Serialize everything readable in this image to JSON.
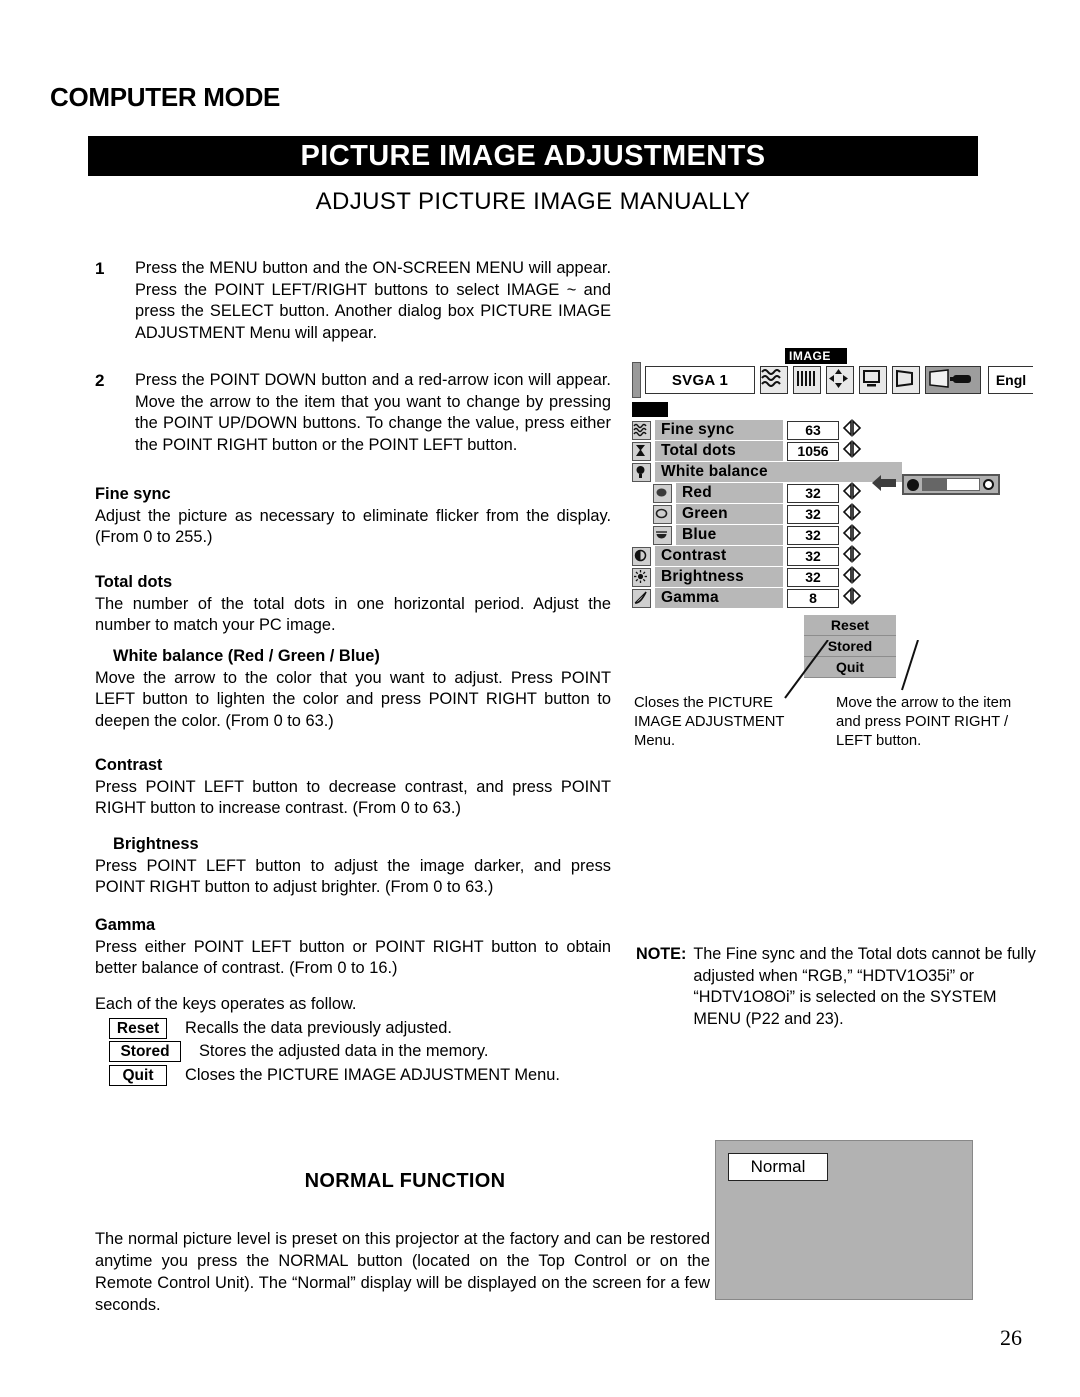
{
  "header": {
    "mode_title": "COMPUTER MODE",
    "banner_title": "PICTURE IMAGE ADJUSTMENTS",
    "subtitle": "ADJUST PICTURE IMAGE MANUALLY"
  },
  "steps": [
    {
      "number": "1",
      "text": "Press the MENU button and the ON-SCREEN MENU will appear. Press the POINT LEFT/RIGHT buttons to select IMAGE ~ and press the SELECT button. Another dialog box PICTURE IMAGE ADJUSTMENT Menu will appear."
    },
    {
      "number": "2",
      "text": "Press the POINT DOWN button and a red-arrow icon will appear. Move the arrow to the item that you want to change by pressing the POINT UP/DOWN buttons. To change the value, press either the POINT RIGHT button or the POINT LEFT button."
    }
  ],
  "sections": [
    {
      "heading": "Fine sync",
      "body": "Adjust the picture as necessary to eliminate flicker from the display. (From 0 to 255.)"
    },
    {
      "heading": "Total dots",
      "body": "The number of the total dots in one horizontal period. Adjust the number to match your PC image."
    },
    {
      "heading": "White balance (Red / Green / Blue)",
      "body": "Move the arrow to the color that you want to adjust. Press POINT LEFT button to lighten the color and press POINT RIGHT button to deepen the color. (From 0 to 63.)"
    },
    {
      "heading": "Contrast",
      "body": "Press POINT LEFT button to decrease contrast, and press POINT RIGHT button to increase contrast. (From 0 to 63.)"
    },
    {
      "heading": "Brightness",
      "body": "Press POINT LEFT button to adjust the image darker, and press POINT RIGHT button to adjust brighter. (From 0 to 63.)"
    },
    {
      "heading": "Gamma",
      "body": "Press either POINT LEFT button or POINT RIGHT button to obtain better balance of contrast. (From 0 to 16.)"
    }
  ],
  "keys": {
    "intro": "Each of the keys operates as follow.",
    "rows": [
      {
        "label": "Reset",
        "description": "Recalls the data previously adjusted."
      },
      {
        "label": "Stored",
        "description": "Stores the adjusted data in the memory."
      },
      {
        "label": "Quit",
        "description": "Closes the PICTURE IMAGE ADJUSTMENT Menu."
      }
    ]
  },
  "osd": {
    "menu_label": "IMAGE",
    "source_label": "SVGA 1",
    "language_label": "Engl",
    "toolbar_icons": [
      "fine-sync-icon",
      "total-dots-icon",
      "position-icon",
      "screen-icon",
      "keystone-icon",
      "image-adjust-icon"
    ],
    "rows": [
      {
        "icon": "fine-sync-icon",
        "label": "Fine sync",
        "value": "63",
        "indent": false,
        "full": false
      },
      {
        "icon": "total-dots-icon",
        "label": "Total dots",
        "value": "1056",
        "indent": false,
        "full": false
      },
      {
        "icon": "white-balance-icon",
        "label": "White balance",
        "value": "",
        "indent": false,
        "full": true
      },
      {
        "icon": "red-icon",
        "label": "Red",
        "value": "32",
        "indent": true,
        "full": false
      },
      {
        "icon": "green-icon",
        "label": "Green",
        "value": "32",
        "indent": true,
        "full": false
      },
      {
        "icon": "blue-icon",
        "label": "Blue",
        "value": "32",
        "indent": true,
        "full": false
      },
      {
        "icon": "contrast-icon",
        "label": "Contrast",
        "value": "32",
        "indent": false,
        "full": false
      },
      {
        "icon": "brightness-icon",
        "label": "Brightness",
        "value": "32",
        "indent": false,
        "full": false
      },
      {
        "icon": "gamma-icon",
        "label": "Gamma",
        "value": "8",
        "indent": false,
        "full": false
      }
    ],
    "buttons": [
      {
        "label": "Reset"
      },
      {
        "label": "Stored"
      },
      {
        "label": "Quit"
      }
    ],
    "callouts": {
      "quit": "Closes the PICTURE IMAGE ADJUSTMENT Menu.",
      "move": "Move the arrow to the item and press POINT RIGHT / LEFT button."
    }
  },
  "note": {
    "label": "NOTE:",
    "text": "The Fine sync and the Total dots cannot be fully adjusted when “RGB,” “HDTV1O35i” or “HDTV1O8Oi” is selected on the SYSTEM MENU (P22 and 23)."
  },
  "normal_function": {
    "heading": "NORMAL FUNCTION",
    "body": "The normal picture level is preset on this projector at the factory and can be restored anytime you press the NORMAL button (located on the Top Control or on the Remote Control Unit). The “Normal” display will be displayed on the screen for a few seconds.",
    "screen_chip_label": "Normal"
  },
  "page_number": "26"
}
